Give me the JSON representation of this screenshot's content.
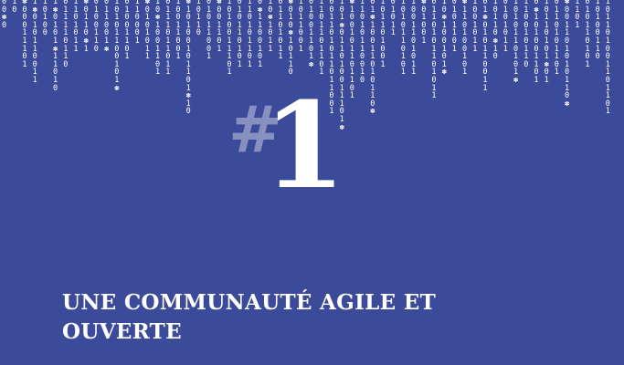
{
  "slide": {
    "hash": "#",
    "number": "1",
    "title": "UNE COMMUNAUTÉ AGILE ET OUVERTE"
  },
  "colors": {
    "background": "#3c4a9a",
    "text": "#ffffff",
    "hash": "#8890bf"
  },
  "icons": {
    "rain_glyph": "✽"
  },
  "binary_rain": [
    "0\n0\n✽\n0",
    "1\n0",
    "✽\n0\n0\n0\n1\n1\n1\n0\n1",
    "1\n✽\n0\n1\n0\n1\n1\n0\n0\n1\n1",
    "1\n0\n1\n0\n0",
    "1\n✽\n0\n1\n0\n1\n✽\n1\n1\n0\n1\n0",
    "0\n1\n1\n1\n1\n0\n1\n1\n0",
    "1\n1\n0\n1\n0\n1\n1",
    "✽\n0\n1\n1\n0\n✽\n1",
    "0\n1\n0\n0\n1\n1\n0",
    "0\n1\n1\n0\n0\n1\n✽",
    "1\n0\n1\n0\n1\n1\n0\n0\n1\n0\n1\n✽",
    "0\n1\n0\n0\n1\n1\n0\n1",
    "1\n1\n0\n0\n0\n1",
    "✽\n0\n1\n0\n1\n0\n1\n1",
    "1\n0\n✽\n1\n0\n0\n1\n1\n0\n1",
    "0\n1\n1\n1\n0\n1\n1\n0\n1\n1",
    "1\n0\n0\n1\n1\n0\n0\n1",
    "✽\n1\n0\n1\n0\n0\n1\n0\n1\n1\n0\n1\n✽\n1\n0",
    "1\n0\n1\n1\n0",
    "0\n1\n0\n1\n1\n0\n0\n1",
    "✽\n0\n0\n1\n1\n0\n1",
    "1\n0\n1\n0\n0\n1\n1\n1\n0\n1",
    "0\n1\n0\n1\n1\n0\n1\n0\n1",
    "1\n1\n0\n1\n0\n1\n1\n0\n1",
    "0\n✽\n1\n1\n0\n0\n1\n0\n1",
    "1\n0\n✽\n1\n0\n1\n1",
    "0\n1\n1\n0\n1\n0\n1\n1",
    "✽\n0\n1\n0\n✽\n1\n0\n1\n1\n0",
    "1\n0\n1\n1\n0\n0\n1",
    "0\n1\n0\n0\n1\n1\n0\n1\n✽",
    "1\n1\n0\n1\n1\n0\n1\n1\n0\n1",
    "0\n0\n1\n1\n0\n1\n0\n1\n1\n0\n1\n1\n0\n0\n1",
    "1\n0\n1\n✽\n0\n1\n1\n0\n1\n0\n0\n1\n1\n1\n0\n1\n✽",
    "✽\n1\n0\n0\n1\n0\n1\n1\n0\n1\n1\n0\n1",
    "1\n1\n0\n1\n0\n1\n1\n0\n0\n1\n0",
    "0\n1\n✽\n1\n0\n0\n1\n1\n0\n1\n0\n1\n1\n0\n✽",
    "1\n0\n1\n1\n0\n1\n0\n0\n1",
    "0\n1\n0\n1\n1",
    "1\n0\n1\n0\n1\n1\n0\n1\n0\n1",
    "1\n0\n0\n1\n1\n0\n1\n0\n1\n1",
    "✽\n0\n1\n0\n0\n1",
    "0\n1\n1\n0\n1\n0\n1\n1\n0\n1\n0\n1\n1",
    "1\n0\n✽\n1\n0\n0\n1\n0\n1\n✽",
    "0\n1\n0\n1\n1\n0\n1",
    "✽\n1\n1\n0\n1\n0\n0\n1\n0\n1",
    "1\n0\n0\n1\n0\n1\n1",
    "0\n1\n✽\n0\n1\n0\n1\n1\n0\n0\n1\n1",
    "1\n0\n1\n1\n0\n✽\n1\n0",
    "0\n1\n0\n1\n0\n1\n1",
    "1\n0\n1\n0\n1\n1\n0\n1\n0\n1\n✽",
    "1\n1\n0\n0\n1\n0\n1\n1\n0",
    "0\n✽\n1\n0\n1\n0\n0\n1\n1\n0\n1",
    "1\n0\n1\n1\n0\n1\n0\n1\n✽\n0\n1",
    "0\n1\n1\n0\n1\n0\n1\n1\n0\n1",
    "✽\n0\n0\n1\n1\n0\n1\n0\n1\n0\n1\n1\n0\n✽",
    "1\n1\n0\n1",
    "0\n1\n0\n1\n1\n0\n1\n0\n1",
    "1\n0\n1\n0\n0\n1\n1\n0",
    "1\n0\n1\n1\n0\n1\n0\n0\n1\n1\n0\n1\n1\n0\n1"
  ]
}
